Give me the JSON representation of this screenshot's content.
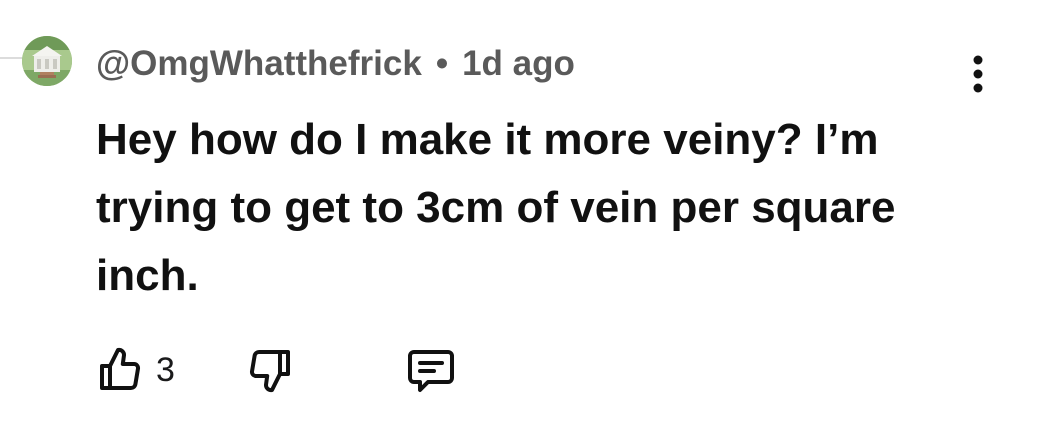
{
  "comment": {
    "username": "@OmgWhatthefrick",
    "separator": "•",
    "timestamp": "1d ago",
    "body": "Hey how do I make it more veiny? I’m trying to get to 3cm of vein per square inch.",
    "avatar_icon": "gazebo-avatar-icon",
    "menu_icon": "vertical-ellipsis-icon"
  },
  "actions": {
    "upvote_icon": "thumbs-up-icon",
    "upvote_count": "3",
    "downvote_icon": "thumbs-down-icon",
    "reply_icon": "comment-bubble-icon"
  }
}
